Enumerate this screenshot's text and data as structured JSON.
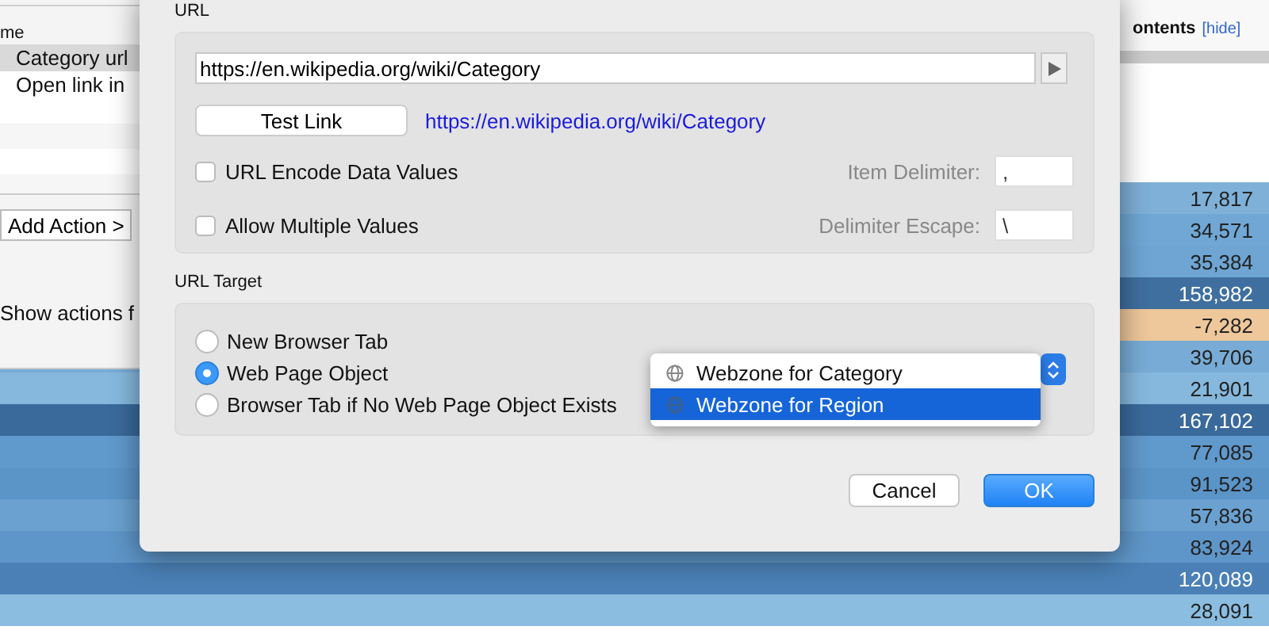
{
  "contents_box": {
    "title": "ontents",
    "hide_link": "[hide]"
  },
  "table": {
    "rows": [
      {
        "value": "17,817",
        "color": "#7fb0d8"
      },
      {
        "value": "34,571",
        "color": "#70a7d4"
      },
      {
        "value": "35,384",
        "color": "#6ea5d3"
      },
      {
        "value": "158,982",
        "color": "#3f6f9f"
      },
      {
        "value": "-7,282",
        "color": "#eec79b"
      },
      {
        "value": "39,706",
        "color": "#78acd6"
      },
      {
        "value": "21,901",
        "color": "#86b8de"
      },
      {
        "value": "167,102",
        "color": "#3a6a9c"
      },
      {
        "value": "77,085",
        "color": "#6099cc"
      },
      {
        "value": "91,523",
        "color": "#5b94c7"
      },
      {
        "value": "57,836",
        "color": "#6aa1d0"
      },
      {
        "value": "83,924",
        "color": "#5e96c9"
      },
      {
        "value": "120,089",
        "color": "#4a80b6"
      },
      {
        "value": "28,091",
        "color": "#8abde0"
      }
    ]
  },
  "background_window": {
    "list_header": "me",
    "list_items": [
      {
        "label": "Category url",
        "selected": true
      },
      {
        "label": "Open link in",
        "selected": false
      }
    ],
    "add_action_button": "Add Action >",
    "show_actions_label": "Show actions f"
  },
  "dialog": {
    "url_section": {
      "title": "URL",
      "url_value": "https://en.wikipedia.org/wiki/Category",
      "test_button": "Test Link",
      "test_link": "https://en.wikipedia.org/wiki/Category",
      "options": [
        {
          "label": "URL Encode Data Values",
          "checked": false,
          "field_label": "Item Delimiter:",
          "field_value": ",",
          "disabled": true
        },
        {
          "label": "Allow Multiple Values",
          "checked": false,
          "field_label": "Delimiter Escape:",
          "field_value": "\\",
          "disabled": true
        }
      ]
    },
    "target_section": {
      "title": "URL Target",
      "options": [
        {
          "label": "New Browser Tab",
          "selected": false
        },
        {
          "label": "Web Page Object",
          "selected": true
        },
        {
          "label": "Browser Tab if No Web Page Object Exists",
          "selected": false
        }
      ],
      "dropdown_items": [
        {
          "label": "Webzone for Category",
          "selected": false
        },
        {
          "label": "Webzone for Region",
          "selected": true
        }
      ]
    },
    "buttons": [
      {
        "label": "Cancel",
        "kind": "secondary"
      },
      {
        "label": "OK",
        "kind": "primary"
      }
    ]
  }
}
